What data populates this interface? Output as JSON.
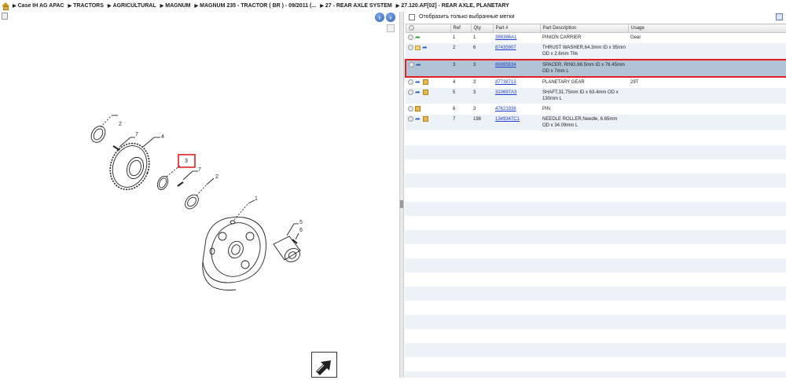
{
  "breadcrumb": [
    "Case IH AG APAC",
    "TRACTORS",
    "AGRICULTURAL",
    "MAGNUM",
    "MAGNUM 235 - TRACTOR ( BR ) - 09/2011 (...",
    "27 - REAR AXLE SYSTEM",
    "27.120.AF[02] - REAR AXLE, PLANETARY"
  ],
  "filter": {
    "label": "Отобразить только выбранные метки"
  },
  "columns": {
    "ref": "Ref",
    "qty": "Qty",
    "part": "Part #",
    "desc": "Part Description",
    "usage": "Usage"
  },
  "rows": [
    {
      "icons": [
        "circle-icon",
        "green-arrow-icon"
      ],
      "ref": "1",
      "qty": "1",
      "part": "388366A1",
      "desc": "PINION CARRIER",
      "usage": "Gear"
    },
    {
      "icons": [
        "circle-icon",
        "folder-icon",
        "blue-arrow-icon"
      ],
      "ref": "2",
      "qty": "6",
      "part": "87435907",
      "desc": "THRUST WASHER,64.3mm ID x 95mm OD x 2.6mm Thk",
      "usage": ""
    },
    {
      "icons": [
        "circle-icon",
        "blue-arrow-icon"
      ],
      "ref": "3",
      "qty": "3",
      "part": "86985634",
      "desc": "SPACER, RING,66.5mm ID x 76.45mm OD x 7mm L",
      "usage": "",
      "selected": true
    },
    {
      "icons": [
        "circle-icon",
        "blue-arrow-icon",
        "box-icon"
      ],
      "ref": "4",
      "qty": "3",
      "part": "87738713",
      "desc": "PLANETARY GEAR",
      "usage": "29T"
    },
    {
      "icons": [
        "circle-icon",
        "blue-arrow-icon",
        "box-icon"
      ],
      "ref": "5",
      "qty": "3",
      "part": "310697A3",
      "desc": "SHAFT,31.75mm ID x 63.4mm OD x 130mm L",
      "usage": ""
    },
    {
      "icons": [
        "circle-icon",
        "box-icon"
      ],
      "ref": "6",
      "qty": "3",
      "part": "47621938",
      "desc": "PIN",
      "usage": ""
    },
    {
      "icons": [
        "circle-icon",
        "blue-arrow-icon",
        "box-icon"
      ],
      "ref": "7",
      "qty": "198",
      "part": "1349347C1",
      "desc": "NEEDLE ROLLER,Needle, 6.65mm OD x 34.09mm L",
      "usage": ""
    }
  ],
  "callouts": [
    "1",
    "2",
    "2",
    "3",
    "4",
    "5",
    "6",
    "7",
    "7"
  ],
  "colors": {
    "link": "#1a3fd0",
    "selected_row": "#b1c3d4",
    "highlight_border": "#e02020",
    "alt_row": "#edf2f8"
  }
}
